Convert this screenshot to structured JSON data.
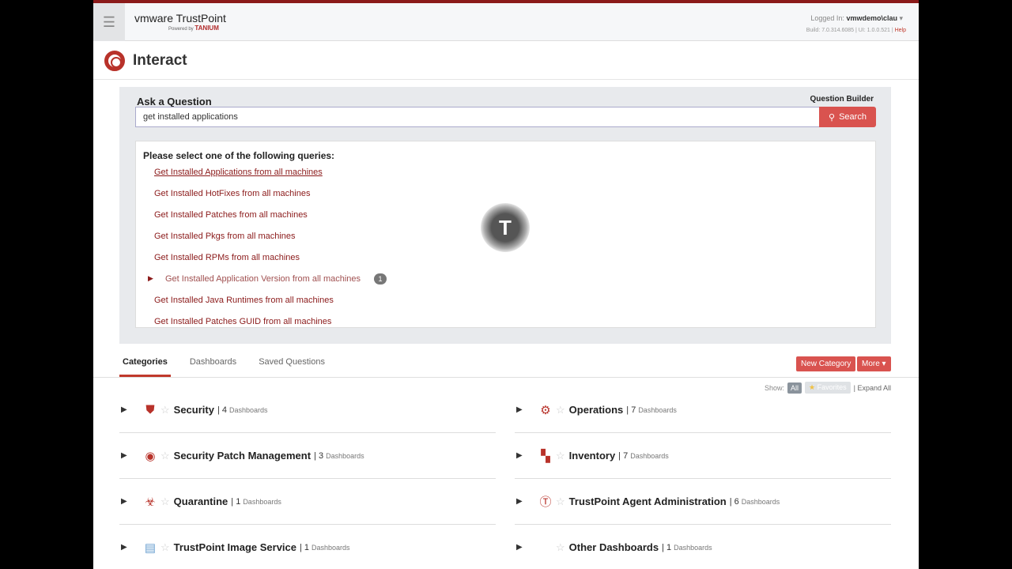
{
  "header": {
    "logo": "vmware TrustPoint",
    "powered_by": "Powered by",
    "powered_brand": "TANIUM",
    "logged_in_label": "Logged In:",
    "user": "vmwdemo\\clau",
    "build": "Build: 7.0.314.6085 | UI: 1.0.0.521 |",
    "help": "Help"
  },
  "page": {
    "title": "Interact"
  },
  "ask": {
    "label": "Ask a Question",
    "question_builder": "Question Builder",
    "input_value": "get installed applications",
    "search_label": "Search",
    "results_title": "Please select one of the following queries:",
    "queries": [
      {
        "text": "Get Installed Applications from all machines"
      },
      {
        "text": "Get Installed HotFixes from all machines"
      },
      {
        "text": "Get Installed Patches from all machines"
      },
      {
        "text": "Get Installed Pkgs from all machines"
      },
      {
        "text": "Get Installed RPMs from all machines"
      },
      {
        "text": "Get Installed Application Version from all machines",
        "badge": "1"
      },
      {
        "text": "Get Installed Java Runtimes from all machines"
      },
      {
        "text": "Get Installed Patches GUID from all machines"
      }
    ]
  },
  "tabs": [
    "Categories",
    "Dashboards",
    "Saved Questions"
  ],
  "actions": {
    "new_category": "New Category",
    "more": "More ▾",
    "show": "Show:",
    "all": "All",
    "favorites": "Favorites",
    "expand_all": "| Expand All"
  },
  "categories": [
    {
      "name": "Security",
      "count": "| 4",
      "unit": "Dashboards",
      "icon": "shield-icon"
    },
    {
      "name": "Operations",
      "count": "| 7",
      "unit": "Dashboards",
      "icon": "gears-icon"
    },
    {
      "name": "Security Patch Management",
      "count": "| 3",
      "unit": "Dashboards",
      "icon": "target-icon"
    },
    {
      "name": "Inventory",
      "count": "| 7",
      "unit": "Dashboards",
      "icon": "boxes-icon"
    },
    {
      "name": "Quarantine",
      "count": "| 1",
      "unit": "Dashboards",
      "icon": "biohazard-icon"
    },
    {
      "name": "TrustPoint Agent Administration",
      "count": "| 6",
      "unit": "Dashboards",
      "icon": "tanium-icon"
    },
    {
      "name": "TrustPoint Image Service",
      "count": "| 1",
      "unit": "Dashboards",
      "icon": "image-service-icon"
    },
    {
      "name": "Other Dashboards",
      "count": "| 1",
      "unit": "Dashboards",
      "icon": ""
    }
  ]
}
